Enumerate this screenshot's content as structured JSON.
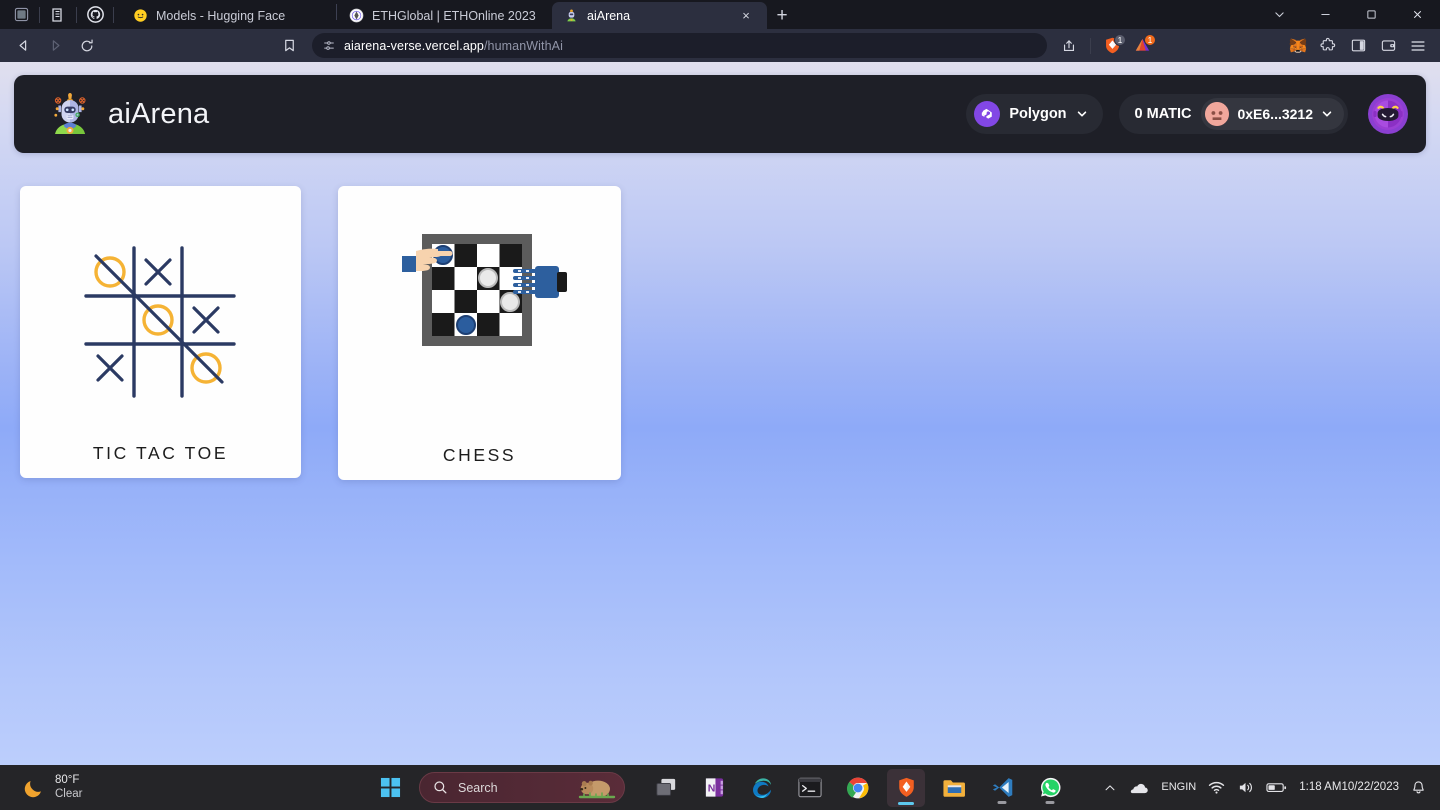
{
  "browser": {
    "quick_icons": [
      "app-tile-icon",
      "docs-icon",
      "github-icon"
    ],
    "tabs": [
      {
        "id": "tab-huggingface",
        "title": "Models - Hugging Face",
        "favicon": "hugging-face-icon",
        "active": false
      },
      {
        "id": "tab-ethglobal",
        "title": "ETHGlobal | ETHOnline 2023",
        "favicon": "ethglobal-icon",
        "active": false
      },
      {
        "id": "tab-aiarena",
        "title": "aiArena",
        "favicon": "robot-icon",
        "active": true
      }
    ],
    "new_tab_label": "+",
    "close_label": "×",
    "window_controls": {
      "minimize": "─",
      "maximize": "❐",
      "close": "✕",
      "tab_search": "ˇ"
    },
    "nav": {
      "back": "back-arrow-icon",
      "forward": "forward-arrow-icon",
      "reload": "reload-icon",
      "bookmark": "bookmark-icon"
    },
    "omnibox": {
      "site_icon": "site-settings-icon",
      "url_host": "aiarena-verse.vercel.app",
      "url_path": "/humanWithAi",
      "share_icon": "share-icon"
    },
    "toolbar_right": {
      "brave_shields": {
        "name": "brave-shields-icon",
        "badge": "1"
      },
      "prism": {
        "name": "prism-extension-icon",
        "badge": "1"
      },
      "metamask": "metamask-fox-icon",
      "extensions": "extensions-puzzle-icon",
      "sidebar": "sidebar-panel-icon",
      "wallet": "brave-wallet-icon",
      "menu": "hamburger-menu-icon"
    }
  },
  "app": {
    "brand": {
      "logo": "ai-robot-logo",
      "name": "aiArena"
    },
    "wallet": {
      "chain": {
        "icon": "polygon-icon",
        "label": "Polygon",
        "chevron": "chevron-down-icon"
      },
      "balance": "0 MATIC",
      "account": {
        "avatar": "account-avatar",
        "address": "0xE6...3212",
        "chevron": "chevron-down-icon"
      },
      "profile_avatar": "purple-robot-avatar"
    },
    "games": [
      {
        "id": "tic-tac-toe",
        "label": "TIC TAC TOE",
        "art": "tic-tac-toe-illustration"
      },
      {
        "id": "chess",
        "label": "CHESS",
        "art": "chess-human-vs-robot-illustration"
      }
    ]
  },
  "taskbar": {
    "weather": {
      "icon": "crescent-moon-icon",
      "temperature": "80°F",
      "condition": "Clear"
    },
    "start": "windows-start-icon",
    "search": {
      "icon": "search-icon",
      "placeholder": "Search",
      "mascot": "wombat-mascot-icon"
    },
    "pinned": [
      {
        "name": "task-view",
        "label": "Task View",
        "state": ""
      },
      {
        "name": "onenote",
        "label": "OneNote",
        "state": ""
      },
      {
        "name": "microsoft-edge",
        "label": "Microsoft Edge",
        "state": ""
      },
      {
        "name": "terminal",
        "label": "Terminal",
        "state": ""
      },
      {
        "name": "google-chrome",
        "label": "Google Chrome",
        "state": ""
      },
      {
        "name": "brave-browser",
        "label": "Brave",
        "state": "active"
      },
      {
        "name": "file-explorer",
        "label": "File Explorer",
        "state": ""
      },
      {
        "name": "vs-code",
        "label": "Visual Studio Code",
        "state": "open"
      },
      {
        "name": "whatsapp",
        "label": "WhatsApp",
        "state": "open"
      }
    ],
    "tray": {
      "overflow": "chevron-up-icon",
      "onedrive": "onedrive-cloud-icon",
      "language": {
        "line1": "ENG",
        "line2": "IN"
      },
      "wifi": "wifi-icon",
      "volume": "speaker-icon",
      "battery": "battery-icon",
      "clock": {
        "time": "1:18 AM",
        "date": "10/22/2023"
      },
      "notifications": "bell-icon"
    }
  },
  "colors": {
    "browser_chrome": "#2c2f3f",
    "tabstrip": "#17181f",
    "app_header": "#1e1f27",
    "polygon_purple": "#8247e5",
    "card_white": "#fefefe",
    "tic_navy": "#2b3a63",
    "tic_gold": "#f5b335",
    "taskbar": "#252528"
  }
}
